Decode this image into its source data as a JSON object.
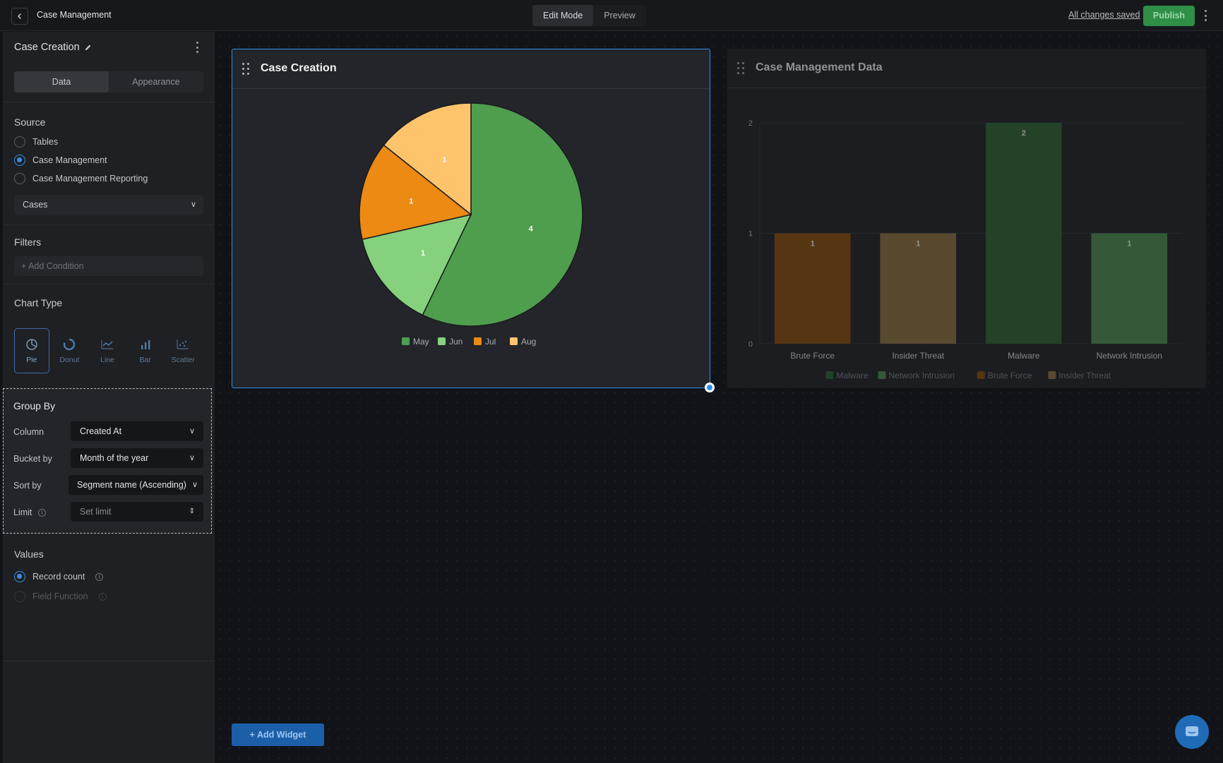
{
  "topbar": {
    "title": "Case Management",
    "modes": [
      "Edit Mode",
      "Preview"
    ],
    "saved_status": "All changes saved",
    "publish_label": "Publish"
  },
  "sidebar": {
    "widget_title": "Case Creation",
    "tabs": [
      "Data",
      "Appearance"
    ],
    "source": {
      "title": "Source",
      "options": [
        "Tables",
        "Case Management",
        "Case Management Reporting"
      ],
      "selected": "Case Management",
      "table_select": "Cases"
    },
    "filters": {
      "title": "Filters",
      "add_condition": "+ Add Condition"
    },
    "chart_type": {
      "title": "Chart Type",
      "types": [
        "Pie",
        "Donut",
        "Line",
        "Bar",
        "Scatter"
      ],
      "selected": "Pie"
    },
    "group_by": {
      "title": "Group By",
      "column_label": "Column",
      "column_value": "Created At",
      "bucket_label": "Bucket by",
      "bucket_value": "Month of the year",
      "sort_label": "Sort by",
      "sort_value": "Segment name (Ascending)",
      "limit_label": "Limit",
      "limit_placeholder": "Set limit"
    },
    "values": {
      "title": "Values",
      "options": [
        "Record count",
        "Field Function"
      ],
      "selected": "Record count"
    }
  },
  "canvas": {
    "add_widget_label": "+ Add Widget"
  },
  "chart_data": [
    {
      "type": "pie",
      "title": "Case Creation",
      "categories": [
        "May",
        "Jun",
        "Jul",
        "Aug"
      ],
      "values": [
        4,
        1,
        1,
        1
      ],
      "colors": [
        "#4e9e4e",
        "#86d17e",
        "#ec8a13",
        "#fdc46b"
      ],
      "legend": "bottom"
    },
    {
      "type": "bar",
      "title": "Case Management Data",
      "categories": [
        "Brute Force",
        "Insider Threat",
        "Malware",
        "Network Intrusion"
      ],
      "values": [
        1,
        1,
        2,
        1
      ],
      "colors": [
        "#7a4509",
        "#7f6538",
        "#285a2c",
        "#457e47"
      ],
      "ylim": [
        0,
        2
      ],
      "yticks": [
        0,
        1,
        2
      ],
      "legend_entries": [
        "Malware",
        "Network Intrusion",
        "Brute Force",
        "Insider Threat"
      ],
      "legend_colors": [
        "#285a2c",
        "#457e47",
        "#7a4509",
        "#7f6538"
      ],
      "legend": "bottom",
      "grid": true
    }
  ]
}
